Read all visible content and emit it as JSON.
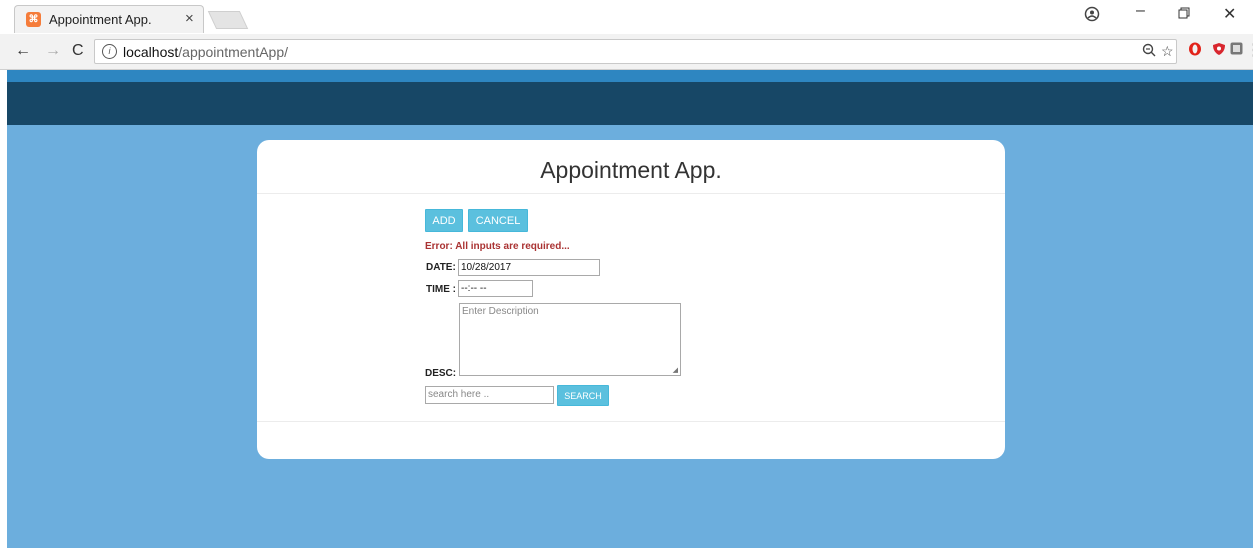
{
  "browser": {
    "tab_title": "Appointment App.",
    "tab_close": "×",
    "favicon_glyph": "⌘",
    "url_host": "localhost",
    "url_path": "/appointmentApp/",
    "icons": [
      "back-icon",
      "forward-icon",
      "reload-icon",
      "info-icon",
      "zoom-icon",
      "star-icon",
      "opera-icon",
      "shield-icon",
      "extension-icon",
      "menu-icon",
      "profile-icon",
      "minimize-icon",
      "restore-icon",
      "close-icon"
    ]
  },
  "colors": {
    "page_bg": "#6caedd",
    "header": "#174766",
    "stripe": "#2e86c1",
    "button": "#5bc0de",
    "error": "#aa3333"
  },
  "app": {
    "title": "Appointment App.",
    "add_label": "ADD",
    "cancel_label": "CANCEL",
    "error_text": "Error: All inputs are required...",
    "date_label": "DATE:",
    "date_value": "10/28/2017",
    "time_label": "TIME :",
    "time_value": "--:-- --",
    "desc_label": "DESC:",
    "desc_placeholder": "Enter Description",
    "search_placeholder": "search here ..",
    "search_label": "SEARCH"
  }
}
